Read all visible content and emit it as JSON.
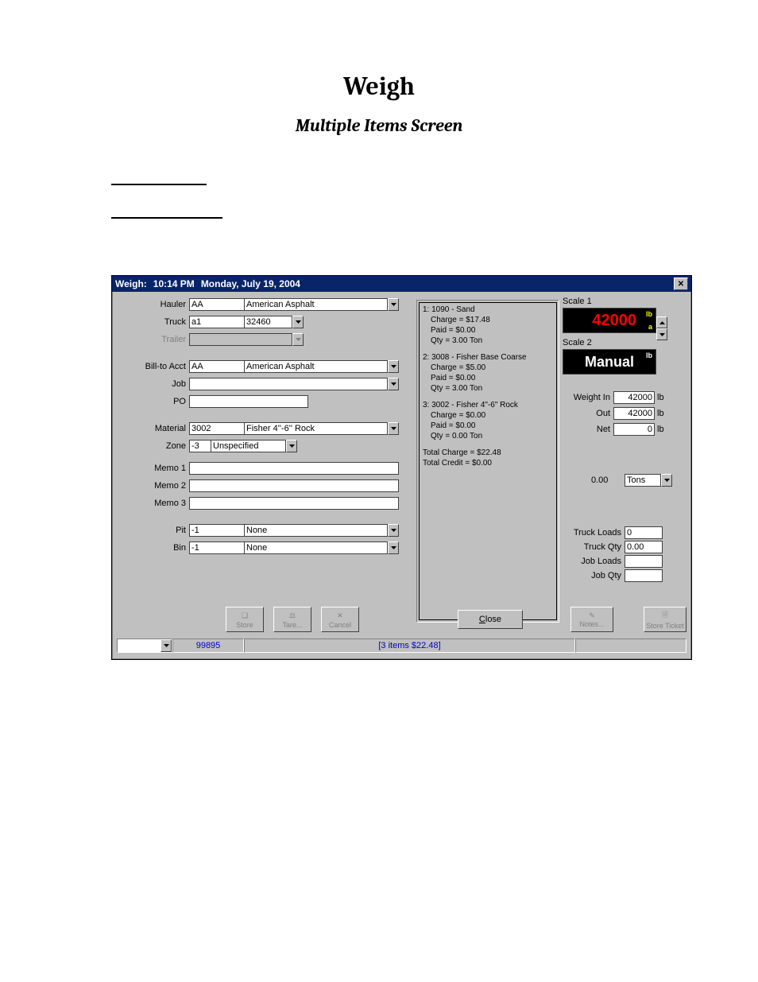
{
  "doc": {
    "title": "Weigh",
    "subtitle": "Multiple Items Screen"
  },
  "titlebar": {
    "prefix": "Weigh:",
    "time": "10:14 PM",
    "date": "Monday, July 19, 2004"
  },
  "form": {
    "hauler_label": "Hauler",
    "hauler_code": "AA",
    "hauler_name": "American Asphalt",
    "truck_label": "Truck",
    "truck_code": "a1",
    "truck_num": "32460",
    "trailer_label": "Trailer",
    "trailer_value": "",
    "billto_label": "Bill-to Acct",
    "billto_code": "AA",
    "billto_name": "American Asphalt",
    "job_label": "Job",
    "job_value": "",
    "po_label": "PO",
    "po_value": "",
    "material_label": "Material",
    "material_code": "3002",
    "material_name": "Fisher 4''-6'' Rock",
    "zone_label": "Zone",
    "zone_code": "-3",
    "zone_name": "Unspecified",
    "memo1_label": "Memo 1",
    "memo1_value": "",
    "memo2_label": "Memo 2",
    "memo2_value": "",
    "memo3_label": "Memo 3",
    "memo3_value": "",
    "pit_label": "Pit",
    "pit_code": "-1",
    "pit_name": "None",
    "bin_label": "Bin",
    "bin_code": "-1",
    "bin_name": "None"
  },
  "summary": {
    "item1_title": "1: 1090 - Sand",
    "item1_charge": "Charge = $17.48",
    "item1_paid": "Paid = $0.00",
    "item1_qty": "Qty = 3.00 Ton",
    "item2_title": "2: 3008 - Fisher Base Coarse",
    "item2_charge": "Charge = $5.00",
    "item2_paid": "Paid = $0.00",
    "item2_qty": "Qty = 3.00 Ton",
    "item3_title": "3: 3002 - Fisher 4\"-6\" Rock",
    "item3_charge": "Charge = $0.00",
    "item3_paid": "Paid = $0.00",
    "item3_qty": "Qty = 0.00 Ton",
    "total_charge": "Total Charge = $22.48",
    "total_credit": "Total Credit = $0.00"
  },
  "scales": {
    "scale1_label": "Scale 1",
    "scale1_value": "42000",
    "scale1_unit_top": "lb",
    "scale1_unit_bot": "a",
    "scale2_label": "Scale 2",
    "scale2_value": "Manual",
    "scale2_unit": "lb",
    "weight_in_label": "Weight In",
    "weight_in_value": "42000",
    "weight_out_label": "Out",
    "weight_out_value": "42000",
    "weight_net_label": "Net",
    "weight_net_value": "0",
    "unit": "lb",
    "conv_value": "0.00",
    "conv_unit": "Tons",
    "truck_loads_label": "Truck Loads",
    "truck_loads_value": "0",
    "truck_qty_label": "Truck Qty",
    "truck_qty_value": "0.00",
    "job_loads_label": "Job Loads",
    "job_loads_value": "",
    "job_qty_label": "Job Qty",
    "job_qty_value": ""
  },
  "buttons": {
    "store": "Store",
    "tare": "Tare...",
    "cancel": "Cancel",
    "close": "Close",
    "notes": "Notes...",
    "store_ticket": "Store Ticket"
  },
  "status": {
    "code": "99895",
    "items": "[3 items  $22.48]"
  }
}
